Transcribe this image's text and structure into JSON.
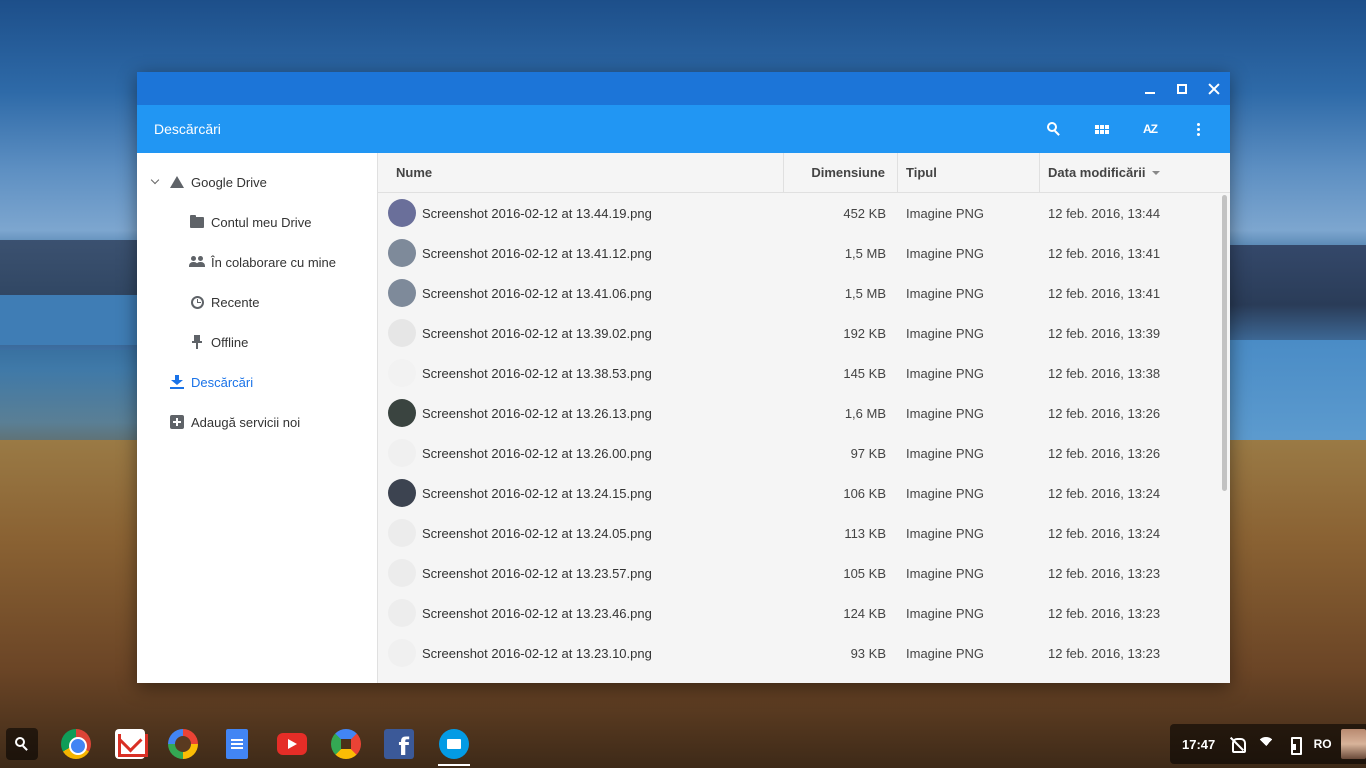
{
  "window": {
    "title": "Descărcări",
    "controls": {
      "minimize_icon": "minimize-icon",
      "maximize_icon": "maximize-icon",
      "close_icon": "close-icon"
    }
  },
  "toolbar": {
    "actions": [
      {
        "icon": "search-icon"
      },
      {
        "icon": "grid-view-icon"
      },
      {
        "icon": "sort-az-icon",
        "label": "AZ"
      },
      {
        "icon": "more-vert-icon"
      }
    ]
  },
  "sidebar": {
    "items": [
      {
        "label": "Google Drive",
        "icon": "google-drive-icon",
        "level": 0,
        "expanded": true
      },
      {
        "label": "Contul meu Drive",
        "icon": "my-drive-icon",
        "level": 1
      },
      {
        "label": "În colaborare cu mine",
        "icon": "shared-with-me-icon",
        "level": 1
      },
      {
        "label": "Recente",
        "icon": "recent-icon",
        "level": 1
      },
      {
        "label": "Offline",
        "icon": "offline-pin-icon",
        "level": 1
      },
      {
        "label": "Descărcări",
        "icon": "download-icon",
        "level": 0,
        "active": true
      },
      {
        "label": "Adaugă servicii noi",
        "icon": "add-box-icon",
        "level": 0
      }
    ]
  },
  "table": {
    "columns": {
      "name": "Nume",
      "size": "Dimensiune",
      "type": "Tipul",
      "date": "Data modificării"
    },
    "sort_column": "date",
    "rows": [
      {
        "name": "Screenshot 2016-02-12 at 13.44.19.png",
        "size": "452 KB",
        "type": "Imagine PNG",
        "date": "12 feb. 2016, 13:44",
        "thumb_color": "#6a6f9a"
      },
      {
        "name": "Screenshot 2016-02-12 at 13.41.12.png",
        "size": "1,5 MB",
        "type": "Imagine PNG",
        "date": "12 feb. 2016, 13:41",
        "thumb_color": "#7e8a9a"
      },
      {
        "name": "Screenshot 2016-02-12 at 13.41.06.png",
        "size": "1,5 MB",
        "type": "Imagine PNG",
        "date": "12 feb. 2016, 13:41",
        "thumb_color": "#7e8a9a"
      },
      {
        "name": "Screenshot 2016-02-12 at 13.39.02.png",
        "size": "192 KB",
        "type": "Imagine PNG",
        "date": "12 feb. 2016, 13:39",
        "thumb_color": "#e6e6e6"
      },
      {
        "name": "Screenshot 2016-02-12 at 13.38.53.png",
        "size": "145 KB",
        "type": "Imagine PNG",
        "date": "12 feb. 2016, 13:38",
        "thumb_color": "#f2f2f2"
      },
      {
        "name": "Screenshot 2016-02-12 at 13.26.13.png",
        "size": "1,6 MB",
        "type": "Imagine PNG",
        "date": "12 feb. 2016, 13:26",
        "thumb_color": "#3a4440"
      },
      {
        "name": "Screenshot 2016-02-12 at 13.26.00.png",
        "size": "97 KB",
        "type": "Imagine PNG",
        "date": "12 feb. 2016, 13:26",
        "thumb_color": "#f0f0f0"
      },
      {
        "name": "Screenshot 2016-02-12 at 13.24.15.png",
        "size": "106 KB",
        "type": "Imagine PNG",
        "date": "12 feb. 2016, 13:24",
        "thumb_color": "#3c4350"
      },
      {
        "name": "Screenshot 2016-02-12 at 13.24.05.png",
        "size": "113 KB",
        "type": "Imagine PNG",
        "date": "12 feb. 2016, 13:24",
        "thumb_color": "#ececec"
      },
      {
        "name": "Screenshot 2016-02-12 at 13.23.57.png",
        "size": "105 KB",
        "type": "Imagine PNG",
        "date": "12 feb. 2016, 13:23",
        "thumb_color": "#ececec"
      },
      {
        "name": "Screenshot 2016-02-12 at 13.23.46.png",
        "size": "124 KB",
        "type": "Imagine PNG",
        "date": "12 feb. 2016, 13:23",
        "thumb_color": "#ededed"
      },
      {
        "name": "Screenshot 2016-02-12 at 13.23.10.png",
        "size": "93 KB",
        "type": "Imagine PNG",
        "date": "12 feb. 2016, 13:23",
        "thumb_color": "#f0f0f0"
      }
    ]
  },
  "shelf": {
    "apps": [
      {
        "name": "launcher",
        "icon": "search-icon"
      },
      {
        "name": "chrome",
        "icon": "chrome-icon"
      },
      {
        "name": "gmail",
        "icon": "gmail-icon"
      },
      {
        "name": "google",
        "icon": "google-icon"
      },
      {
        "name": "docs",
        "icon": "docs-icon"
      },
      {
        "name": "youtube",
        "icon": "youtube-icon"
      },
      {
        "name": "photos",
        "icon": "photos-icon"
      },
      {
        "name": "facebook",
        "icon": "facebook-icon",
        "label": "f"
      },
      {
        "name": "files",
        "icon": "files-icon",
        "active": true
      }
    ],
    "tray": {
      "time": "17:47",
      "lang": "RO",
      "icons": [
        "notifications-off-icon",
        "wifi-icon",
        "battery-icon",
        "avatar"
      ]
    }
  },
  "colors": {
    "titlebar": "#1c75d8",
    "toolbar": "#2196f3",
    "accent": "#1a73e8",
    "list_bg": "#f5f5f5"
  }
}
